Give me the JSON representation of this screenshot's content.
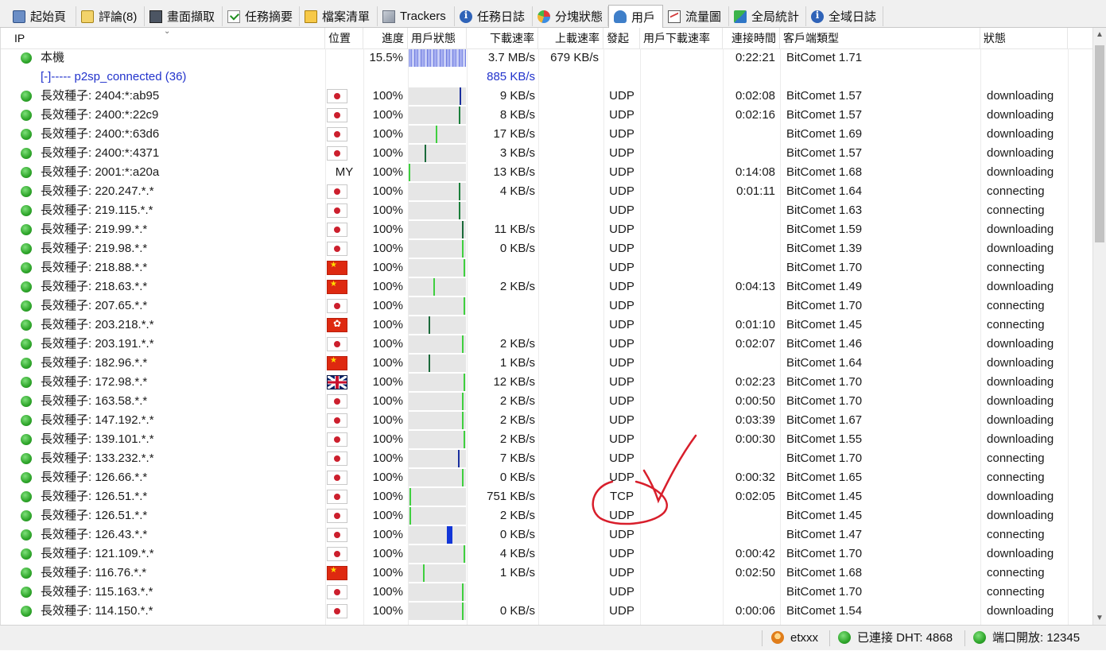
{
  "tabs": [
    {
      "label": "起始頁",
      "icon": "home-icon",
      "key": "home"
    },
    {
      "label": "評論(8)",
      "icon": "comment-icon",
      "key": "comment"
    },
    {
      "label": "畫面擷取",
      "icon": "screenshot-icon",
      "key": "screen"
    },
    {
      "label": "任務摘要",
      "icon": "checklist-icon",
      "key": "summary"
    },
    {
      "label": "檔案清單",
      "icon": "files-icon",
      "key": "files"
    },
    {
      "label": "Trackers",
      "icon": "trackers-icon",
      "key": "trackers"
    },
    {
      "label": "任務日誌",
      "icon": "info-icon",
      "key": "log"
    },
    {
      "label": "分塊狀態",
      "icon": "pie-chart-icon",
      "key": "pie"
    },
    {
      "label": "用戶",
      "icon": "users-icon",
      "key": "peers",
      "active": true
    },
    {
      "label": "流量圖",
      "icon": "line-graph-icon",
      "key": "graph"
    },
    {
      "label": "全局統計",
      "icon": "statistics-icon",
      "key": "global"
    },
    {
      "label": "全域日誌",
      "icon": "info-icon",
      "key": "glog"
    }
  ],
  "columns": [
    {
      "key": "ip",
      "label": "IP"
    },
    {
      "key": "location",
      "label": "位置"
    },
    {
      "key": "progress",
      "label": "進度"
    },
    {
      "key": "user_status",
      "label": "用戶狀態"
    },
    {
      "key": "down",
      "label": "下載速率"
    },
    {
      "key": "up",
      "label": "上載速率"
    },
    {
      "key": "initiator",
      "label": "發起"
    },
    {
      "key": "user_down",
      "label": "用戶下載速率"
    },
    {
      "key": "conn_time",
      "label": "連接時間"
    },
    {
      "key": "client",
      "label": "客戶端類型"
    },
    {
      "key": "state",
      "label": "狀態"
    }
  ],
  "local_row": {
    "ip": "本機",
    "progress": "15.5%",
    "down": "3.7 MB/s",
    "up": "679 KB/s",
    "conn_time": "0:22:21",
    "client": "BitComet 1.71"
  },
  "group_row": {
    "label": "[-]----- p2sp_connected (36)",
    "down": "885 KB/s"
  },
  "peers": [
    {
      "ip": "長效種子: 2404:*:ab95",
      "loc": "jp",
      "progress": "100%",
      "bar": 0.92,
      "barColor": "#1a2f9e",
      "down": "9 KB/s",
      "proto": "UDP",
      "time": "0:02:08",
      "client": "BitComet 1.57",
      "state": "downloading"
    },
    {
      "ip": "長效種子: 2400:*:22c9",
      "loc": "jp",
      "progress": "100%",
      "bar": 0.9,
      "barColor": "#1a7f3a",
      "down": "8 KB/s",
      "proto": "UDP",
      "time": "0:02:16",
      "client": "BitComet 1.57",
      "state": "downloading"
    },
    {
      "ip": "長效種子: 2400:*:63d6",
      "loc": "jp",
      "progress": "100%",
      "bar": 0.48,
      "barColor": "#3fcf3f",
      "down": "17 KB/s",
      "proto": "UDP",
      "time": "",
      "client": "BitComet 1.69",
      "state": "downloading"
    },
    {
      "ip": "長效種子: 2400:*:4371",
      "loc": "jp",
      "progress": "100%",
      "bar": 0.28,
      "barColor": "#1a6a3a",
      "down": "3 KB/s",
      "proto": "UDP",
      "time": "",
      "client": "BitComet 1.57",
      "state": "downloading"
    },
    {
      "ip": "長效種子: 2001:*:a20a",
      "loc": "MY",
      "progress": "100%",
      "bar": 0.0,
      "barColor": "#3fcf3f",
      "down": "13 KB/s",
      "proto": "UDP",
      "time": "0:14:08",
      "client": "BitComet 1.68",
      "state": "downloading"
    },
    {
      "ip": "長效種子: 220.247.*.*",
      "loc": "jp",
      "progress": "100%",
      "bar": 0.9,
      "barColor": "#1a7f3a",
      "down": "4 KB/s",
      "proto": "UDP",
      "time": "0:01:11",
      "client": "BitComet 1.64",
      "state": "connecting"
    },
    {
      "ip": "長效種子: 219.115.*.*",
      "loc": "jp",
      "progress": "100%",
      "bar": 0.9,
      "barColor": "#1a7f3a",
      "down": "",
      "proto": "UDP",
      "time": "",
      "client": "BitComet 1.63",
      "state": "connecting"
    },
    {
      "ip": "長效種子: 219.99.*.*",
      "loc": "jp",
      "progress": "100%",
      "bar": 0.96,
      "barColor": "#1a6a3a",
      "down": "11 KB/s",
      "proto": "UDP",
      "time": "",
      "client": "BitComet 1.59",
      "state": "downloading"
    },
    {
      "ip": "長效種子: 219.98.*.*",
      "loc": "jp",
      "progress": "100%",
      "bar": 0.96,
      "barColor": "#3fcf3f",
      "down": "0 KB/s",
      "proto": "UDP",
      "time": "",
      "client": "BitComet 1.39",
      "state": "downloading"
    },
    {
      "ip": "長效種子: 218.88.*.*",
      "loc": "cn",
      "progress": "100%",
      "bar": 0.98,
      "barColor": "#3fcf3f",
      "down": "",
      "proto": "UDP",
      "time": "",
      "client": "BitComet 1.70",
      "state": "connecting"
    },
    {
      "ip": "長效種子: 218.63.*.*",
      "loc": "cn",
      "progress": "100%",
      "bar": 0.44,
      "barColor": "#3fcf3f",
      "down": "2 KB/s",
      "proto": "UDP",
      "time": "0:04:13",
      "client": "BitComet 1.49",
      "state": "downloading"
    },
    {
      "ip": "長效種子: 207.65.*.*",
      "loc": "jp",
      "progress": "100%",
      "bar": 0.98,
      "barColor": "#3fcf3f",
      "down": "",
      "proto": "UDP",
      "time": "",
      "client": "BitComet 1.70",
      "state": "connecting"
    },
    {
      "ip": "長效種子: 203.218.*.*",
      "loc": "hk",
      "progress": "100%",
      "bar": 0.36,
      "barColor": "#1a6a3a",
      "down": "",
      "proto": "UDP",
      "time": "0:01:10",
      "client": "BitComet 1.45",
      "state": "connecting"
    },
    {
      "ip": "長效種子: 203.191.*.*",
      "loc": "jp",
      "progress": "100%",
      "bar": 0.96,
      "barColor": "#3fcf3f",
      "down": "2 KB/s",
      "proto": "UDP",
      "time": "0:02:07",
      "client": "BitComet 1.46",
      "state": "downloading"
    },
    {
      "ip": "長效種子: 182.96.*.*",
      "loc": "cn",
      "progress": "100%",
      "bar": 0.36,
      "barColor": "#1a6a3a",
      "down": "1 KB/s",
      "proto": "UDP",
      "time": "",
      "client": "BitComet 1.64",
      "state": "downloading"
    },
    {
      "ip": "長效種子: 172.98.*.*",
      "loc": "gb",
      "progress": "100%",
      "bar": 0.98,
      "barColor": "#3fcf3f",
      "down": "12 KB/s",
      "proto": "UDP",
      "time": "0:02:23",
      "client": "BitComet 1.70",
      "state": "downloading"
    },
    {
      "ip": "長效種子: 163.58.*.*",
      "loc": "jp",
      "progress": "100%",
      "bar": 0.96,
      "barColor": "#3fcf3f",
      "down": "2 KB/s",
      "proto": "UDP",
      "time": "0:00:50",
      "client": "BitComet 1.70",
      "state": "downloading"
    },
    {
      "ip": "長效種子: 147.192.*.*",
      "loc": "jp",
      "progress": "100%",
      "bar": 0.96,
      "barColor": "#3fcf3f",
      "down": "2 KB/s",
      "proto": "UDP",
      "time": "0:03:39",
      "client": "BitComet 1.67",
      "state": "downloading"
    },
    {
      "ip": "長效種子: 139.101.*.*",
      "loc": "jp",
      "progress": "100%",
      "bar": 0.98,
      "barColor": "#3fcf3f",
      "down": "2 KB/s",
      "proto": "UDP",
      "time": "0:00:30",
      "client": "BitComet 1.55",
      "state": "downloading"
    },
    {
      "ip": "長效種子: 133.232.*.*",
      "loc": "jp",
      "progress": "100%",
      "bar": 0.89,
      "barColor": "#1a2f9e",
      "down": "7 KB/s",
      "proto": "UDP",
      "time": "",
      "client": "BitComet 1.70",
      "state": "connecting"
    },
    {
      "ip": "長效種子: 126.66.*.*",
      "loc": "jp",
      "progress": "100%",
      "bar": 0.96,
      "barColor": "#3fcf3f",
      "down": "0 KB/s",
      "proto": "UDP",
      "time": "0:00:32",
      "client": "BitComet 1.65",
      "state": "connecting"
    },
    {
      "ip": "長效種子: 126.51.*.*",
      "loc": "jp",
      "progress": "100%",
      "bar": 0.02,
      "barColor": "#3fcf3f",
      "down": "751 KB/s",
      "proto": "TCP",
      "time": "0:02:05",
      "client": "BitComet 1.45",
      "state": "downloading"
    },
    {
      "ip": "長效種子: 126.51.*.*",
      "loc": "jp",
      "progress": "100%",
      "bar": 0.02,
      "barColor": "#3fcf3f",
      "down": "2 KB/s",
      "proto": "UDP",
      "time": "",
      "client": "BitComet 1.45",
      "state": "downloading"
    },
    {
      "ip": "長效種子: 126.43.*.*",
      "loc": "jp",
      "progress": "100%",
      "bar": 0.68,
      "barColor": "#1236d8",
      "down": "0 KB/s",
      "proto": "UDP",
      "time": "",
      "client": "BitComet 1.47",
      "state": "connecting"
    },
    {
      "ip": "長效種子: 121.109.*.*",
      "loc": "jp",
      "progress": "100%",
      "bar": 0.98,
      "barColor": "#3fcf3f",
      "down": "4 KB/s",
      "proto": "UDP",
      "time": "0:00:42",
      "client": "BitComet 1.70",
      "state": "downloading"
    },
    {
      "ip": "長效種子: 116.76.*.*",
      "loc": "cn",
      "progress": "100%",
      "bar": 0.26,
      "barColor": "#3fcf3f",
      "down": "1 KB/s",
      "proto": "UDP",
      "time": "0:02:50",
      "client": "BitComet 1.68",
      "state": "connecting"
    },
    {
      "ip": "長效種子: 115.163.*.*",
      "loc": "jp",
      "progress": "100%",
      "bar": 0.96,
      "barColor": "#3fcf3f",
      "down": "",
      "proto": "UDP",
      "time": "",
      "client": "BitComet 1.70",
      "state": "connecting"
    },
    {
      "ip": "長效種子: 114.150.*.*",
      "loc": "jp",
      "progress": "100%",
      "bar": 0.96,
      "barColor": "#3fcf3f",
      "down": "0 KB/s",
      "proto": "UDP",
      "time": "0:00:06",
      "client": "BitComet 1.54",
      "state": "downloading"
    }
  ],
  "statusbar": {
    "user": "etxxx",
    "dht": "已連接 DHT: 4868",
    "port": "端口開放: 12345"
  },
  "colors": {
    "group_text": "#2233cc",
    "annotation": "#d81e2b"
  }
}
